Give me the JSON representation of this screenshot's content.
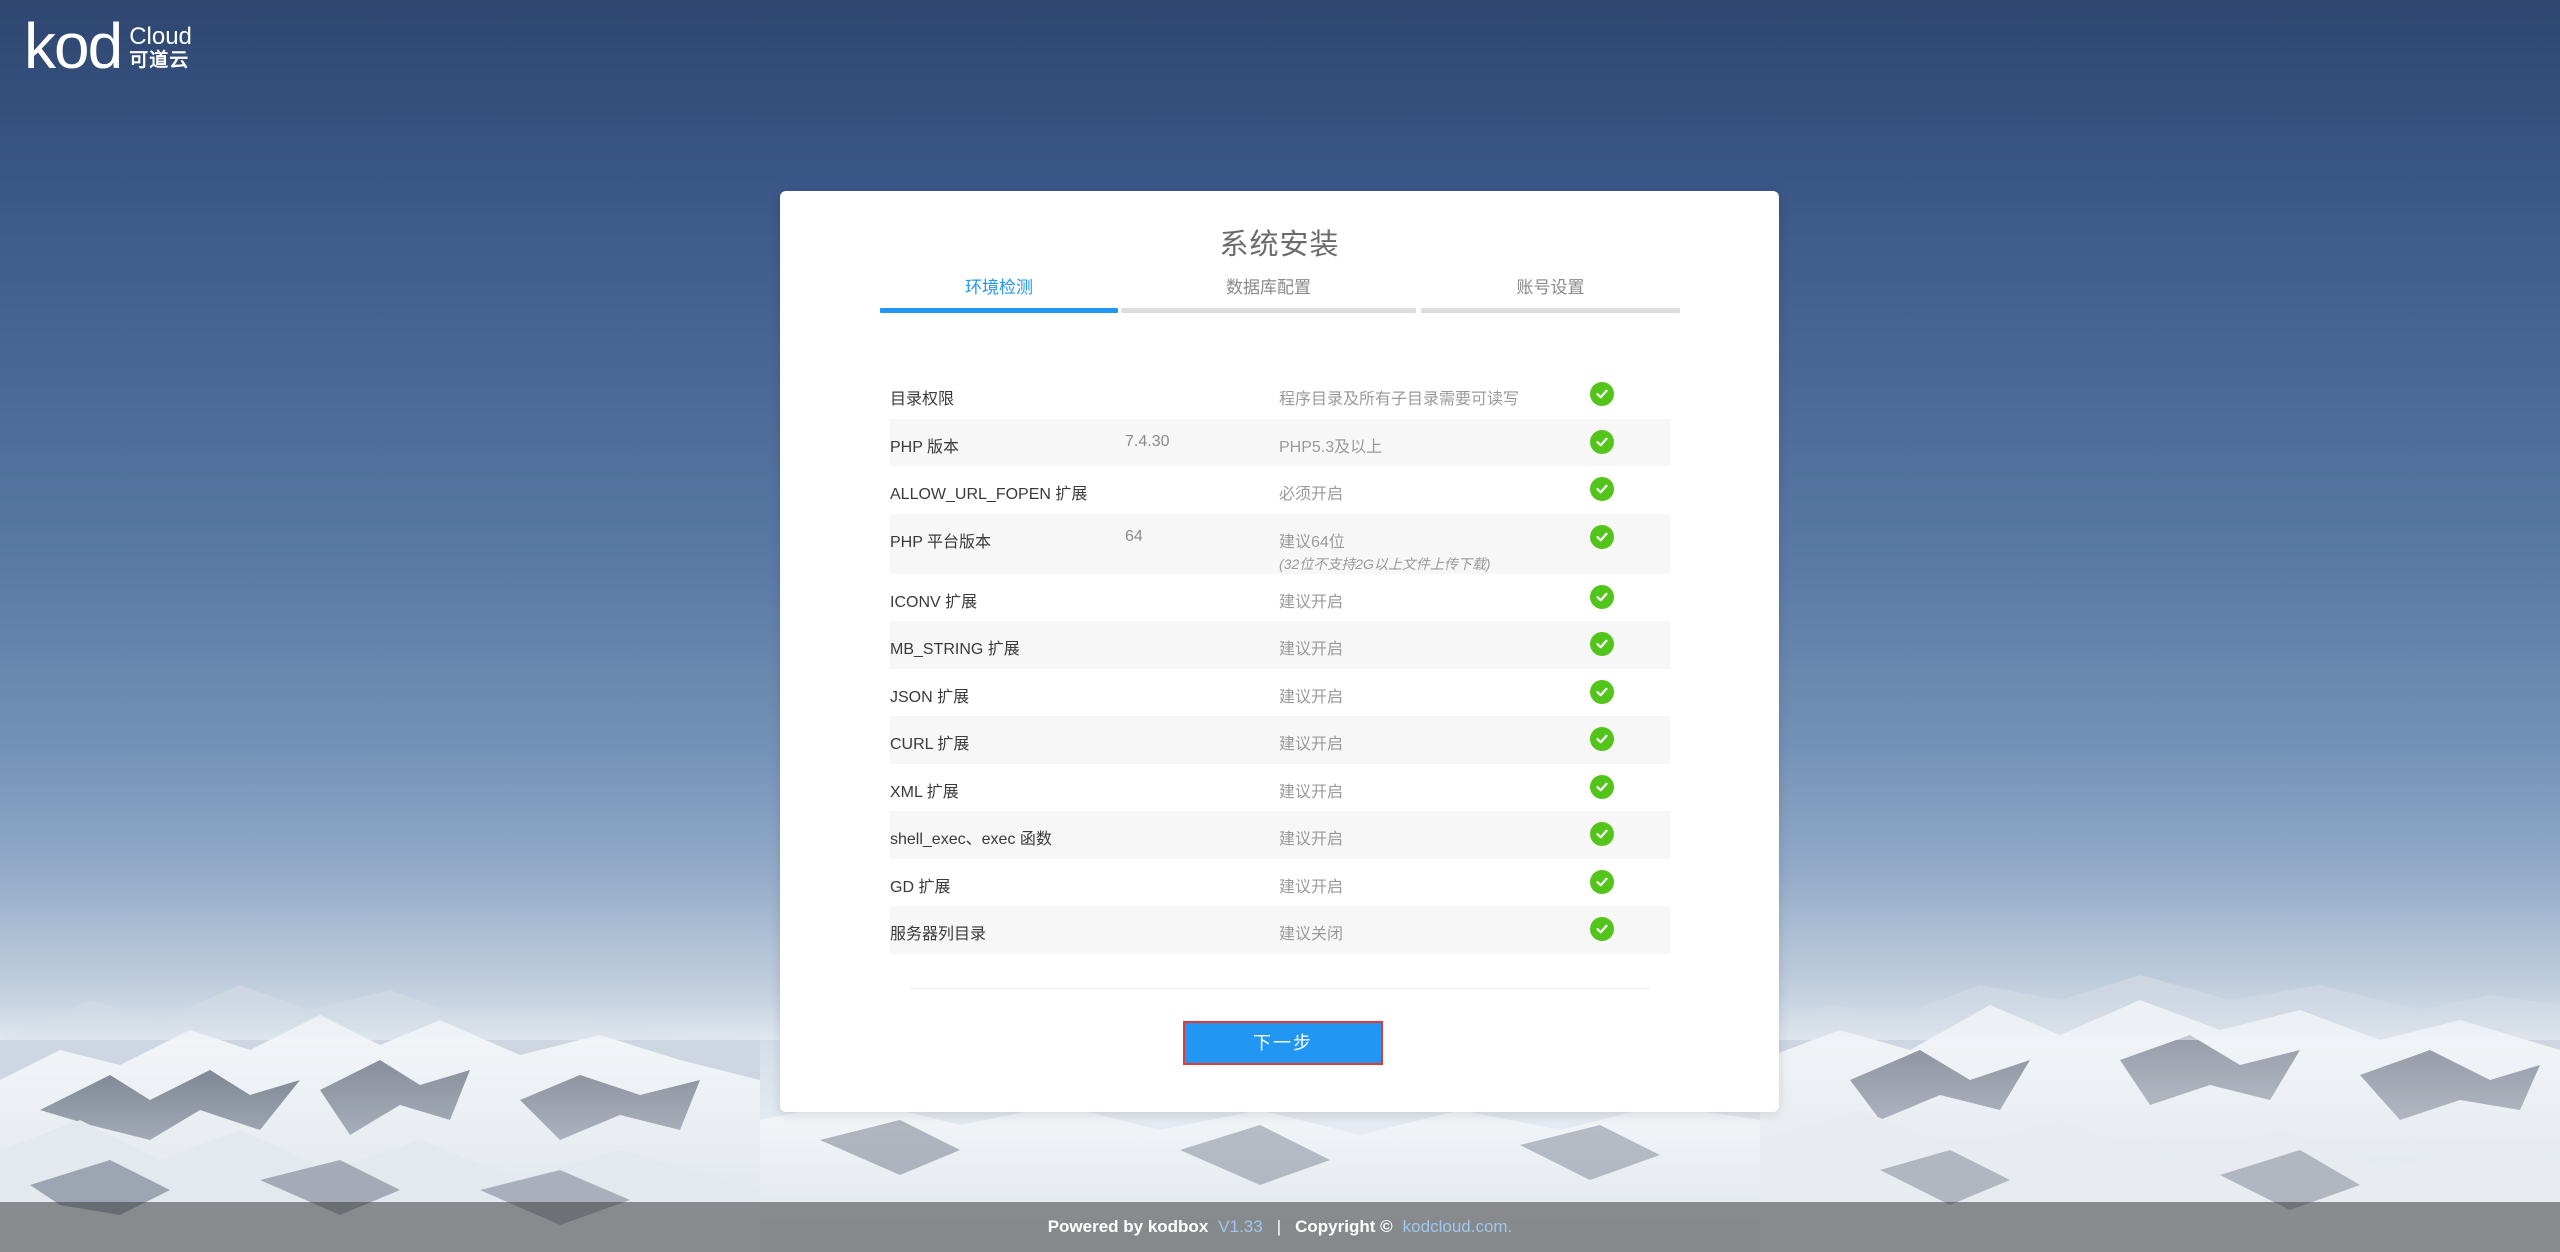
{
  "logo": {
    "mark": "kod",
    "cloud": "Cloud",
    "cn": "可道云"
  },
  "card": {
    "title": "系统安装",
    "steps": [
      {
        "label": "环境检测",
        "active": true
      },
      {
        "label": "数据库配置",
        "active": false
      },
      {
        "label": "账号设置",
        "active": false
      }
    ],
    "checks": [
      {
        "name": "目录权限",
        "value": "",
        "requirement": "程序目录及所有子目录需要可读写",
        "note": "",
        "status": "ok"
      },
      {
        "name": "PHP 版本",
        "value": "7.4.30",
        "requirement": "PHP5.3及以上",
        "note": "",
        "status": "ok"
      },
      {
        "name": "ALLOW_URL_FOPEN 扩展",
        "value": "",
        "requirement": "必须开启",
        "note": "",
        "status": "ok"
      },
      {
        "name": "PHP 平台版本",
        "value": "64",
        "requirement": "建议64位",
        "note": "(32位不支持2G以上文件上传下载)",
        "status": "ok"
      },
      {
        "name": "ICONV 扩展",
        "value": "",
        "requirement": "建议开启",
        "note": "",
        "status": "ok"
      },
      {
        "name": "MB_STRING 扩展",
        "value": "",
        "requirement": "建议开启",
        "note": "",
        "status": "ok"
      },
      {
        "name": "JSON 扩展",
        "value": "",
        "requirement": "建议开启",
        "note": "",
        "status": "ok"
      },
      {
        "name": "CURL 扩展",
        "value": "",
        "requirement": "建议开启",
        "note": "",
        "status": "ok"
      },
      {
        "name": "XML 扩展",
        "value": "",
        "requirement": "建议开启",
        "note": "",
        "status": "ok"
      },
      {
        "name": "shell_exec、exec 函数",
        "value": "",
        "requirement": "建议开启",
        "note": "",
        "status": "ok"
      },
      {
        "name": "GD 扩展",
        "value": "",
        "requirement": "建议开启",
        "note": "",
        "status": "ok"
      },
      {
        "name": "服务器列目录",
        "value": "",
        "requirement": "建议关闭",
        "note": "",
        "status": "ok"
      }
    ],
    "next_label": "下一步"
  },
  "footer": {
    "powered": "Powered by kodbox",
    "version": "V1.33",
    "separator": "|",
    "copyright": "Copyright ©",
    "link": "kodcloud.com."
  },
  "colors": {
    "accent": "#2196f3",
    "ok": "#52c41a",
    "highlight_border": "#e53935"
  },
  "icons": {
    "status_ok": "check-circle-icon"
  }
}
